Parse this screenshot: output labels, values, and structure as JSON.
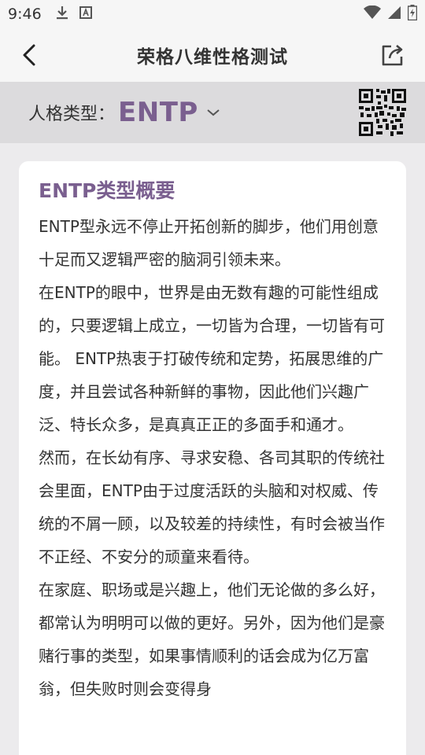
{
  "status_bar": {
    "time": "9:46"
  },
  "header": {
    "title": "荣格八维性格测试"
  },
  "type_bar": {
    "label": "人格类型：",
    "value": "ENTP"
  },
  "card": {
    "title": "ENTP类型概要",
    "paragraphs": [
      "ENTP型永远不停止开拓创新的脚步，他们用创意十足而又逻辑严密的脑洞引领未来。",
      "在ENTP的眼中，世界是由无数有趣的可能性组成的，只要逻辑上成立，一切皆为合理，一切皆有可能。 ENTP热衷于打破传统和定势，拓展思维的广度，并且尝试各种新鲜的事物，因此他们兴趣广泛、特长众多，是真真正正的多面手和通才。",
      "然而，在长幼有序、寻求安稳、各司其职的传统社会里面，ENTP由于过度活跃的头脑和对权威、传统的不屑一顾，以及较差的持续性，有时会被当作不正经、不安分的顽童来看待。",
      "在家庭、职场或是兴趣上，他们无论做的多么好，都常认为明明可以做的更好。另外，因为他们是豪赌行事的类型，如果事情顺利的话会成为亿万富翁，但失败时则会变得身"
    ]
  },
  "colors": {
    "accent": "#7a5f8f",
    "background": "#ecebed",
    "type_bar": "#dcdbdd"
  },
  "icons": [
    "download-icon",
    "a-box-icon",
    "wifi-icon",
    "signal-icon",
    "battery-icon",
    "back-arrow-icon",
    "share-icon",
    "chevron-down-icon",
    "qr-code-icon"
  ]
}
